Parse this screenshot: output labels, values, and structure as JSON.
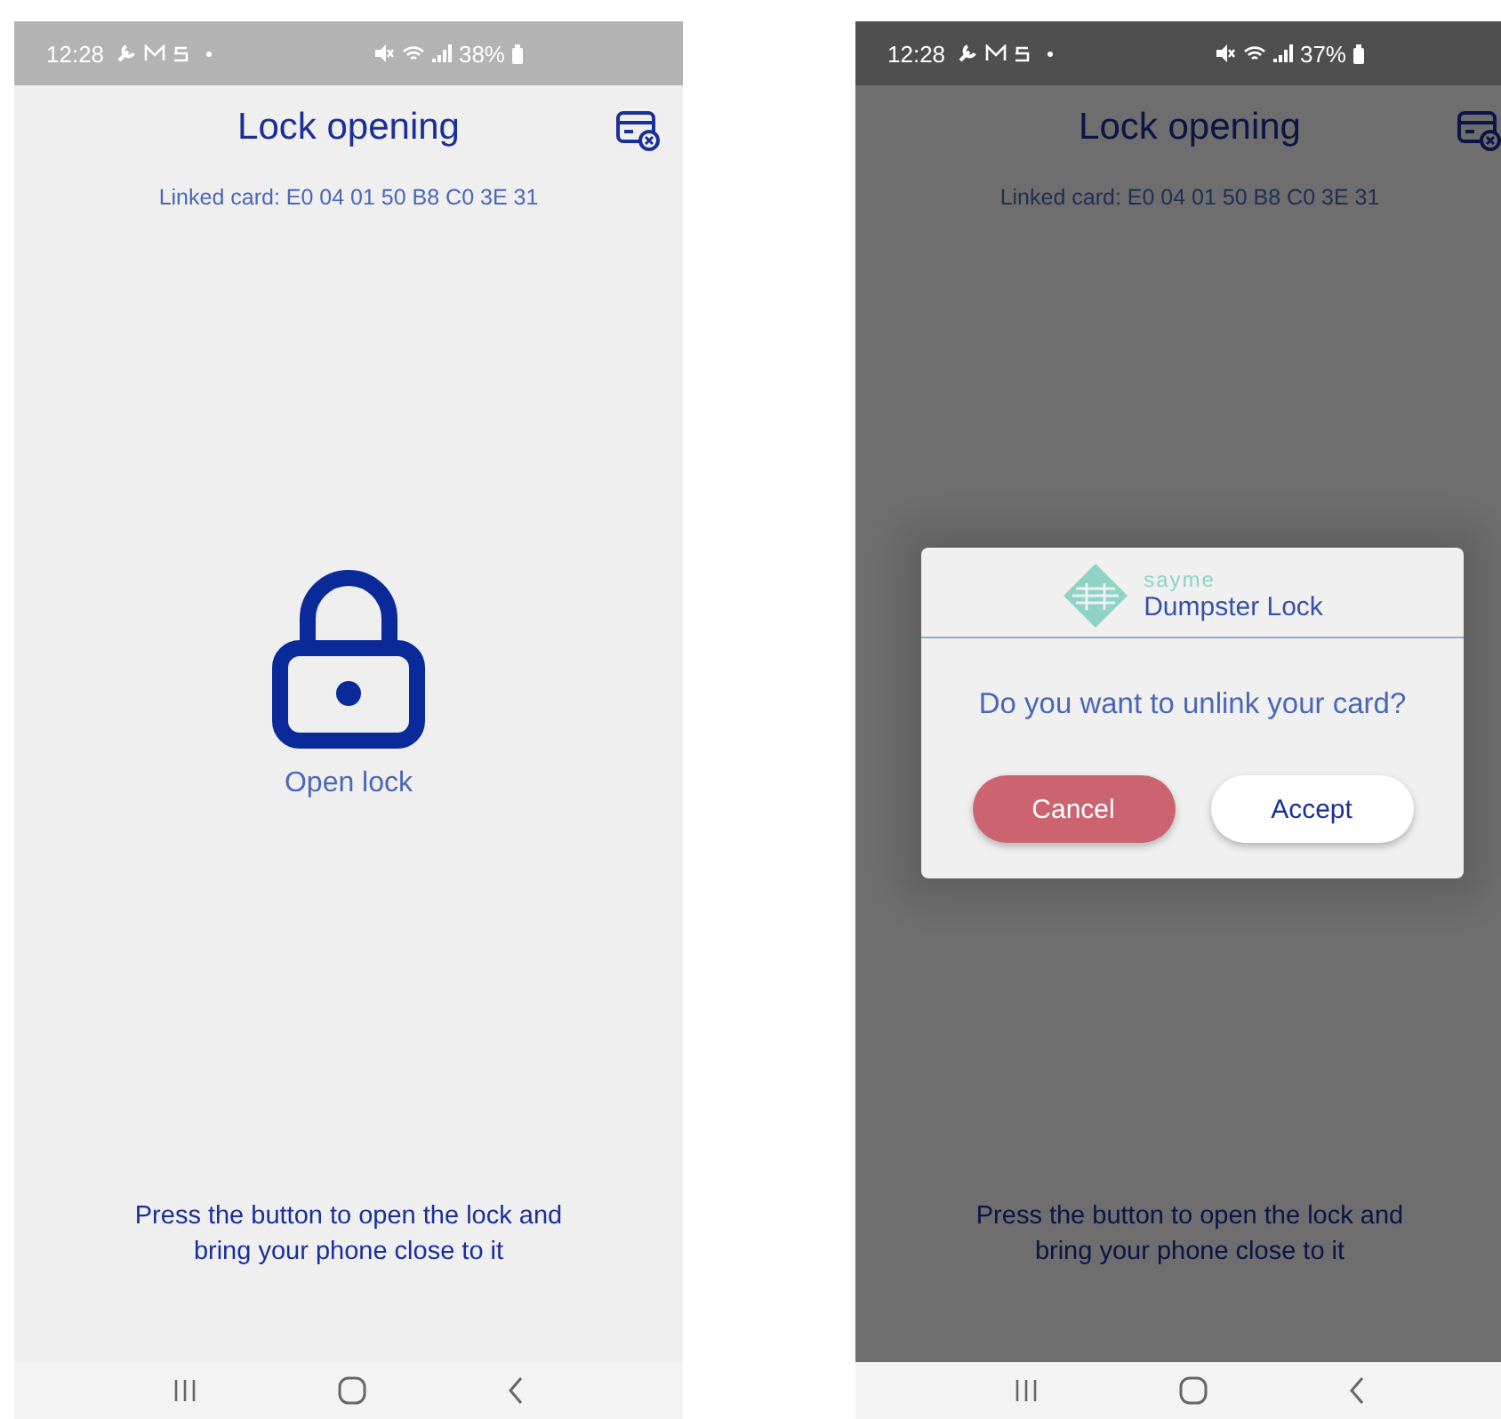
{
  "screens": [
    {
      "status_bar": {
        "time": "12:28",
        "battery": "38%"
      },
      "title": "Lock opening",
      "linked_card": "Linked card: E0 04 01 50 B8 C0 3E 31",
      "lock_label": "Open lock",
      "instruction": "Press the button to open the lock and bring your phone close to it"
    },
    {
      "status_bar": {
        "time": "12:28",
        "battery": "37%"
      },
      "title": "Lock opening",
      "linked_card": "Linked card: E0 04 01 50 B8 C0 3E 31",
      "instruction": "Press the button to open the lock and bring your phone close to it",
      "dialog": {
        "brand": "sayme",
        "app_name": "Dumpster Lock",
        "message": "Do you want to unlink your card?",
        "buttons": [
          {
            "label": "Cancel",
            "kind": "cancel"
          },
          {
            "label": "Accept",
            "kind": "accept"
          }
        ]
      }
    }
  ]
}
